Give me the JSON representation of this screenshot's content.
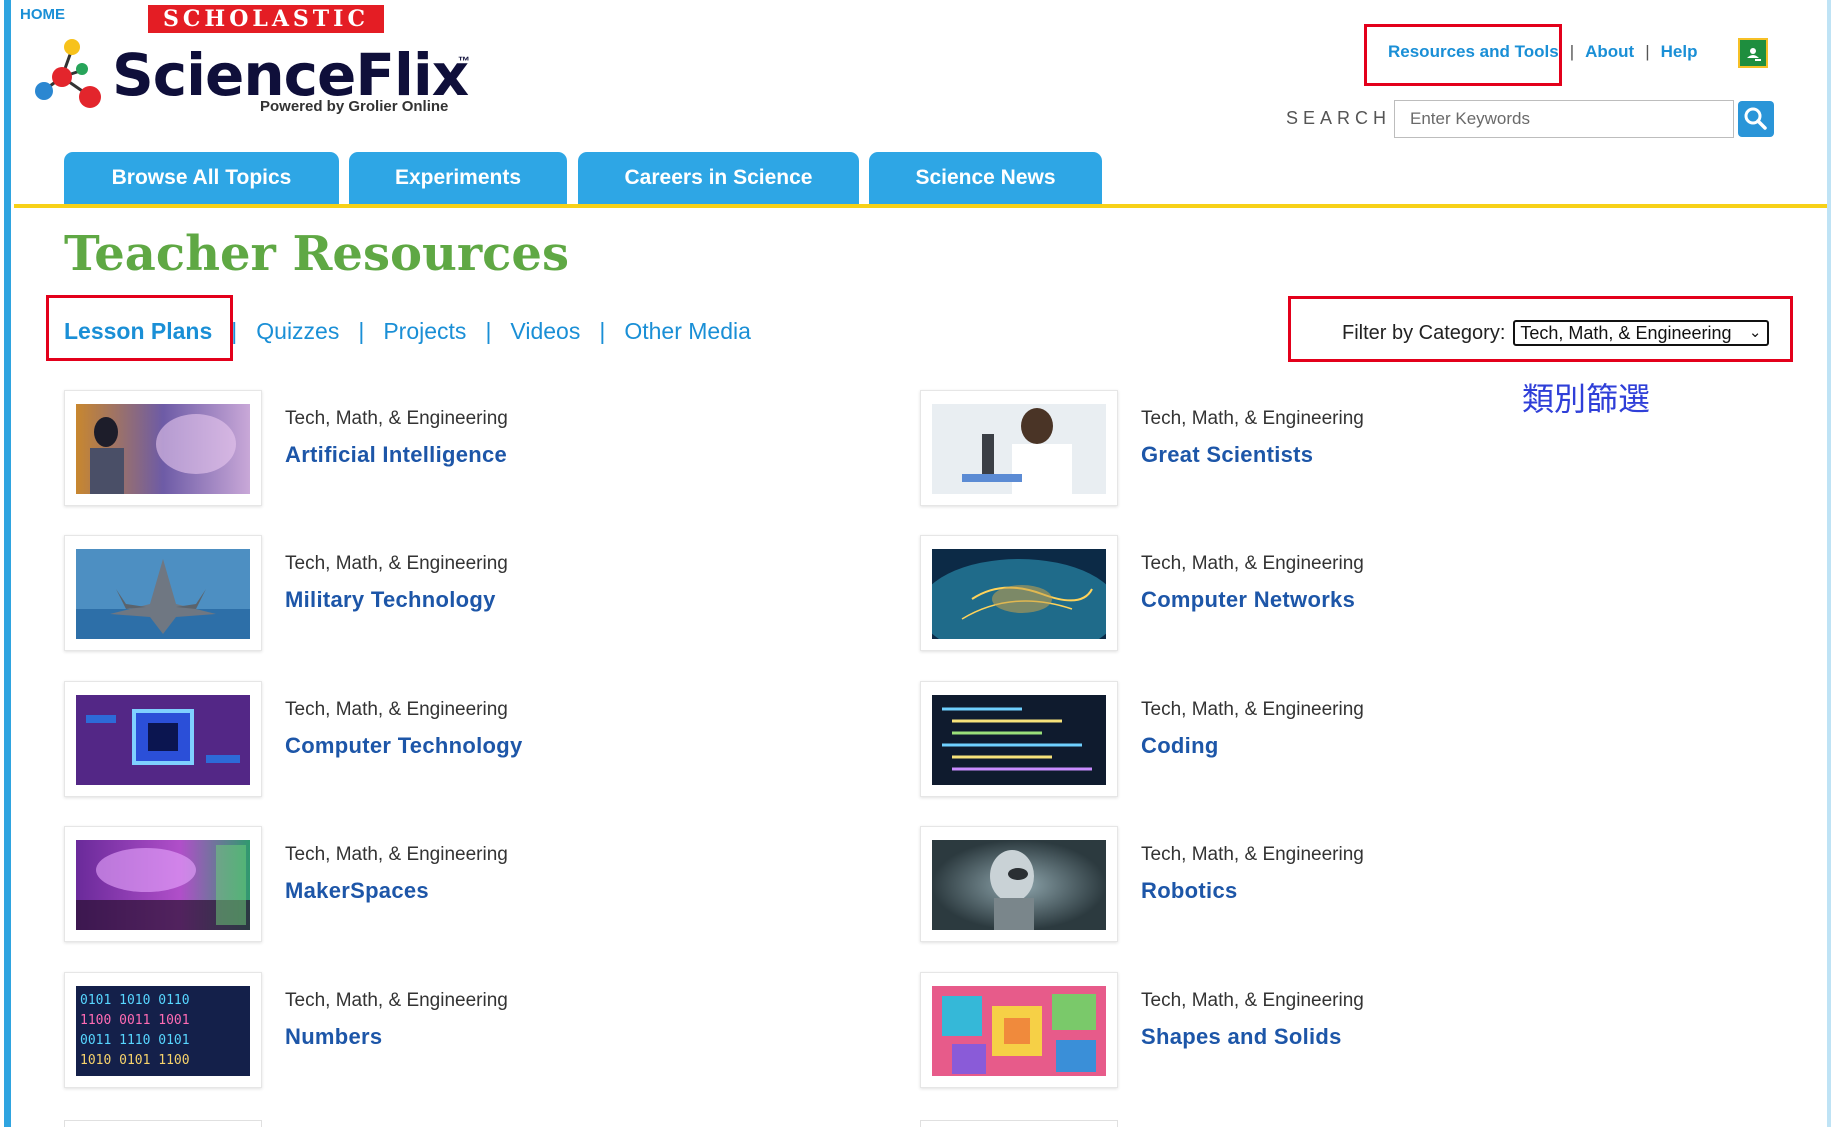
{
  "header": {
    "home_label": "HOME",
    "publisher": "SCHOLASTIC",
    "logo_text": "ScienceFlix",
    "logo_tm": "™",
    "logo_subtitle": "Powered by Grolier Online",
    "links": {
      "resources": "Resources and Tools",
      "about": "About",
      "help": "Help",
      "separator": "|"
    },
    "search": {
      "label": "SEARCH",
      "placeholder": "Enter Keywords"
    }
  },
  "nav": {
    "tabs": [
      {
        "label": "Browse All Topics"
      },
      {
        "label": "Experiments"
      },
      {
        "label": "Careers in Science"
      },
      {
        "label": "Science News"
      }
    ]
  },
  "main": {
    "title": "Teacher Resources",
    "subtabs": [
      {
        "label": "Lesson Plans",
        "active": true
      },
      {
        "label": "Quizzes"
      },
      {
        "label": "Projects"
      },
      {
        "label": "Videos"
      },
      {
        "label": "Other Media"
      }
    ],
    "separator": "|",
    "filter": {
      "label": "Filter by Category:",
      "selected": "Tech, Math, & Engineering"
    },
    "annotation": "類別篩選",
    "cards": [
      {
        "category": "Tech, Math, & Engineering",
        "title": "Artificial Intelligence"
      },
      {
        "category": "Tech, Math, & Engineering",
        "title": "Great Scientists"
      },
      {
        "category": "Tech, Math, & Engineering",
        "title": "Military Technology"
      },
      {
        "category": "Tech, Math, & Engineering",
        "title": "Computer Networks"
      },
      {
        "category": "Tech, Math, & Engineering",
        "title": "Computer Technology"
      },
      {
        "category": "Tech, Math, & Engineering",
        "title": "Coding"
      },
      {
        "category": "Tech, Math, & Engineering",
        "title": "MakerSpaces"
      },
      {
        "category": "Tech, Math, & Engineering",
        "title": "Robotics"
      },
      {
        "category": "Tech, Math, & Engineering",
        "title": "Numbers"
      },
      {
        "category": "Tech, Math, & Engineering",
        "title": "Shapes and Solids"
      }
    ]
  },
  "colors": {
    "accent_blue": "#2ea6e5",
    "link_blue": "#1a8fd6",
    "title_green": "#5fa844",
    "nav_rule_yellow": "#f7d117",
    "highlight_red": "#e3001b"
  }
}
